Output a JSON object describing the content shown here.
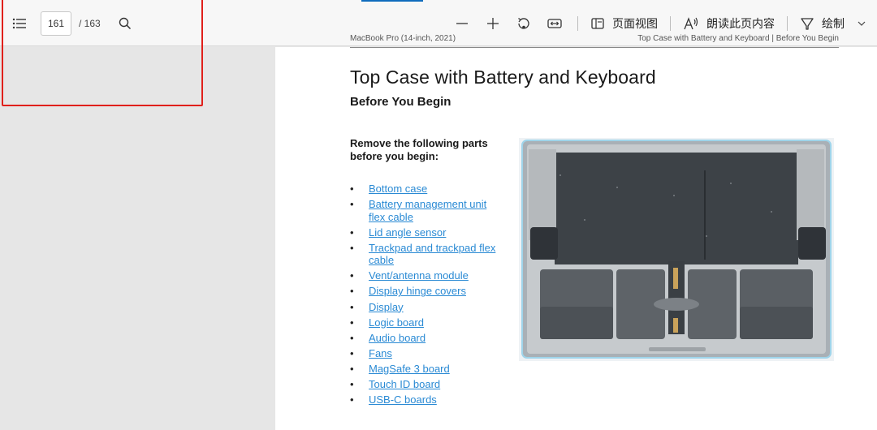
{
  "toolbar": {
    "page_number": "161",
    "page_total": "/ 163",
    "page_view_label": "页面视图",
    "read_aloud_label": "朗读此页内容",
    "draw_label": "绘制"
  },
  "page": {
    "header_left": "MacBook Pro (14-inch, 2021)",
    "header_right": "Top Case with Battery and Keyboard | Before You Begin",
    "title": "Top Case with Battery and Keyboard",
    "subtitle": "Before You Begin",
    "intro": "Remove the following parts before you begin:",
    "parts": [
      "Bottom case",
      "Battery management unit flex cable",
      "Lid angle sensor",
      "Trackpad and trackpad flex cable",
      "Vent/antenna module",
      "Display hinge covers",
      "Display",
      "Logic board",
      "Audio board",
      "Fans",
      "MagSafe 3 board",
      "Touch ID board",
      "USB-C boards"
    ]
  },
  "colors": {
    "link": "#2a8ad4",
    "highlight_box": "#e0201b",
    "toolbar_bg": "#f7f7f7",
    "canvas_bg": "#e6e6e6"
  },
  "icons": [
    "contents-icon",
    "search-icon",
    "zoom-out-icon",
    "zoom-in-icon",
    "rotate-icon",
    "fit-width-icon",
    "page-view-icon",
    "read-aloud-icon",
    "draw-icon",
    "chevron-down-icon"
  ]
}
